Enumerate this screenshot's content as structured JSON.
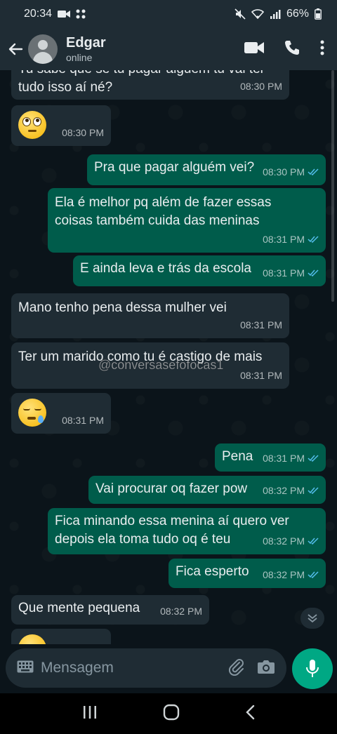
{
  "status_bar": {
    "time": "20:34",
    "battery": "66%"
  },
  "header": {
    "contact_name": "Edgar",
    "contact_status": "online"
  },
  "messages": [
    {
      "direction": "in",
      "text": "Tu sabe que se tu pagar alguém tu vai ter\ntudo isso aí né?",
      "time": "08:30 PM"
    },
    {
      "direction": "in",
      "emoji": "face-with-rolling-eyes",
      "time": "08:30 PM"
    },
    {
      "direction": "out",
      "text": "Pra que pagar alguém vei?",
      "time": "08:30 PM",
      "read": true
    },
    {
      "direction": "out",
      "text": "Ela é melhor pq além de fazer essas\ncoisas também cuida das meninas",
      "time": "08:31 PM",
      "read": true
    },
    {
      "direction": "out",
      "text": "E ainda leva e trás da escola",
      "time": "08:31 PM",
      "read": true
    },
    {
      "direction": "in",
      "text": "Mano tenho pena dessa mulher vei",
      "time": "08:31 PM"
    },
    {
      "direction": "in",
      "text": "Ter um marido como tu é castigo de mais",
      "time": "08:31 PM"
    },
    {
      "direction": "in",
      "emoji": "sleepy-face",
      "time": "08:31 PM"
    },
    {
      "direction": "out",
      "text": "Pena",
      "time": "08:31 PM",
      "read": true
    },
    {
      "direction": "out",
      "text": "Vai procurar oq fazer pow",
      "time": "08:32 PM",
      "read": true
    },
    {
      "direction": "out",
      "text": "Fica minando essa menina aí quero ver\ndepois ela toma tudo oq é teu",
      "time": "08:32 PM",
      "read": true
    },
    {
      "direction": "out",
      "text": "Fica esperto",
      "time": "08:32 PM",
      "read": true
    },
    {
      "direction": "in",
      "text": "Que mente pequena",
      "time": "08:32 PM"
    }
  ],
  "watermark": "@conversasefofocas1",
  "composer": {
    "placeholder": "Mensagem"
  },
  "colors": {
    "chat_bg": "#0b141a",
    "incoming_bubble": "#1f2c34",
    "outgoing_bubble": "#005c4b",
    "accent": "#00a884",
    "read_tick": "#53bdeb"
  }
}
